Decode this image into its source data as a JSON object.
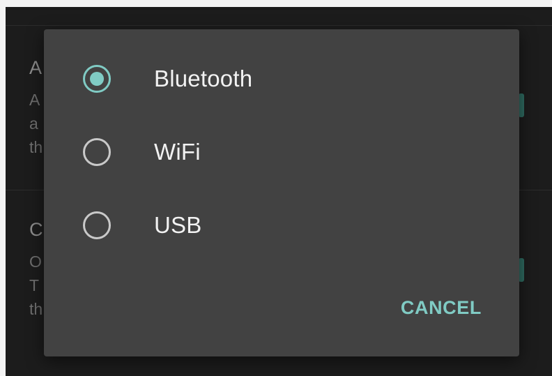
{
  "dialog": {
    "options": [
      {
        "label": "Bluetooth",
        "selected": true
      },
      {
        "label": "WiFi",
        "selected": false
      },
      {
        "label": "USB",
        "selected": false
      }
    ],
    "cancel_label": "CANCEL"
  },
  "background": {
    "section1_line1": "A",
    "section1_line2": "A",
    "section1_line3": "a",
    "section1_line4": "th",
    "section2_line1": "C",
    "section2_line2": "O",
    "section2_line3": "T",
    "section2_line4": "th"
  },
  "colors": {
    "accent": "#80cbc4",
    "dialog_bg": "#424242",
    "screen_bg": "#1c1c1c"
  }
}
